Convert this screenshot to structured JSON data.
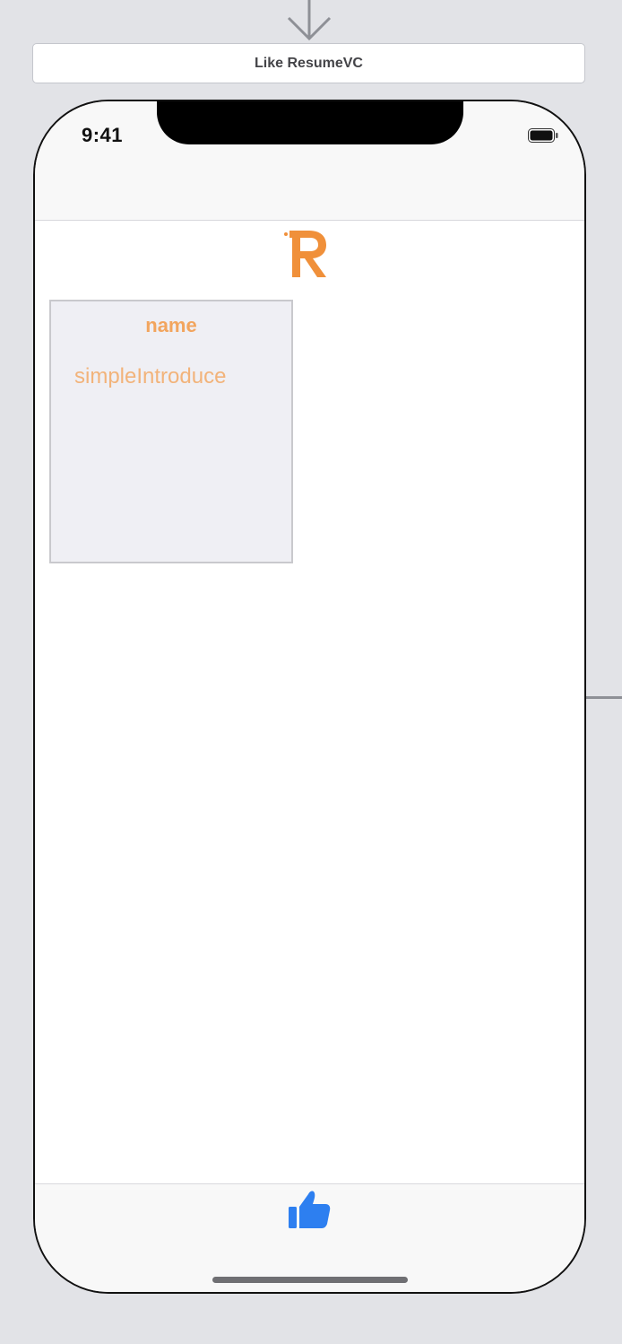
{
  "scene": {
    "title": "Like ResumeVC"
  },
  "status_bar": {
    "time": "9:41",
    "battery_icon": "battery-full-icon"
  },
  "header": {
    "logo_icon": "r-logo-icon"
  },
  "card": {
    "name": "name",
    "intro": "simpleIntroduce"
  },
  "tab_bar": {
    "icon": "thumbs-up-icon"
  },
  "colors": {
    "canvas_bg": "#e2e3e7",
    "accent_orange": "#f2a55e",
    "accent_blue": "#2d7ff0"
  }
}
